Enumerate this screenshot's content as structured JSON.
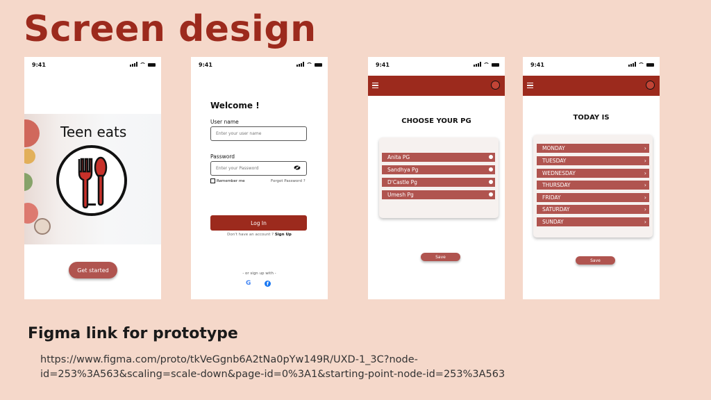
{
  "page": {
    "title": "Screen design",
    "figma_heading": "Figma link for prototype",
    "figma_url_line1": "https://www.figma.com/proto/tkVeGgnb6A2tNa0pYw149R/UXD-1_3C?node-",
    "figma_url_line2": "id=253%3A563&scaling=scale-down&page-id=0%3A1&starting-point-node-id=253%3A563"
  },
  "colors": {
    "background": "#f5d8ca",
    "accent": "#9c2a1d",
    "button": "#b0544f"
  },
  "status_time": "9:41",
  "splash": {
    "brand": "Teen eats",
    "button": "Get started"
  },
  "login": {
    "welcome": "Welcome !",
    "username_label": "User name",
    "username_placeholder": "Enter your user name",
    "password_label": "Password",
    "password_placeholder": "Enter your Password",
    "remember": "Remember me",
    "forgot": "Forgot Password ?",
    "login_button": "Log In",
    "no_account": "Don't have an account ?",
    "sign_up": "Sign Up",
    "or_sign_up": "- or sign up with -",
    "google_glyph": "G",
    "facebook_glyph": "f"
  },
  "pg": {
    "heading": "CHOOSE YOUR PG",
    "options": [
      "Anita PG",
      "Sandhya Pg",
      "D'Castle Pg",
      "Umesh Pg"
    ],
    "save": "Save"
  },
  "days": {
    "heading": "TODAY IS",
    "options": [
      "MONDAY",
      "TUESDAY",
      "WEDNESDAY",
      "THURSDAY",
      "FRIDAY",
      "SATURDAY",
      "SUNDAY"
    ],
    "chevron": "›",
    "save": "Save"
  }
}
